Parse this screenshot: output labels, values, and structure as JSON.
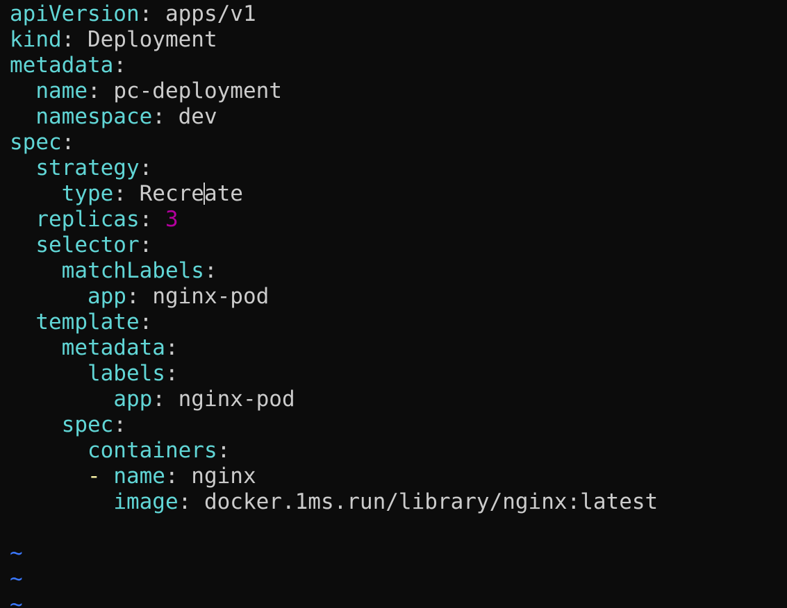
{
  "editor": {
    "lines": [
      {
        "key": "apiVersion",
        "sep": ": ",
        "value": "apps/v1"
      },
      {
        "key": "kind",
        "sep": ": ",
        "value": "Deployment"
      },
      {
        "key": "metadata",
        "sep": ":"
      },
      {
        "key": "name",
        "sep": ": ",
        "value": "pc-deployment"
      },
      {
        "key": "namespace",
        "sep": ": ",
        "value": "dev"
      },
      {
        "key": "spec",
        "sep": ":"
      },
      {
        "key": "strategy",
        "sep": ":"
      },
      {
        "key": "type",
        "sep": ": ",
        "value_before_cursor": "Recre",
        "value_after_cursor": "ate"
      },
      {
        "key": "replicas",
        "sep": ": ",
        "number": "3"
      },
      {
        "key": "selector",
        "sep": ":"
      },
      {
        "key": "matchLabels",
        "sep": ":"
      },
      {
        "key": "app",
        "sep": ": ",
        "value": "nginx-pod"
      },
      {
        "key": "template",
        "sep": ":"
      },
      {
        "key": "metadata",
        "sep": ":"
      },
      {
        "key": "labels",
        "sep": ":"
      },
      {
        "key": "app",
        "sep": ": ",
        "value": "nginx-pod"
      },
      {
        "key": "spec",
        "sep": ":"
      },
      {
        "key": "containers",
        "sep": ":"
      },
      {
        "dash": "- ",
        "key": "name",
        "sep": ": ",
        "value": "nginx"
      },
      {
        "key": "image",
        "sep": ": ",
        "value": "docker.1ms.run/library/nginx:latest"
      }
    ],
    "tilde": "~"
  },
  "colors": {
    "background": "#0c0c0c",
    "key": "#61d6d6",
    "text": "#cccccc",
    "number": "#b4009e",
    "list_dash": "#f9f1a5",
    "tilde": "#3b78ff"
  }
}
